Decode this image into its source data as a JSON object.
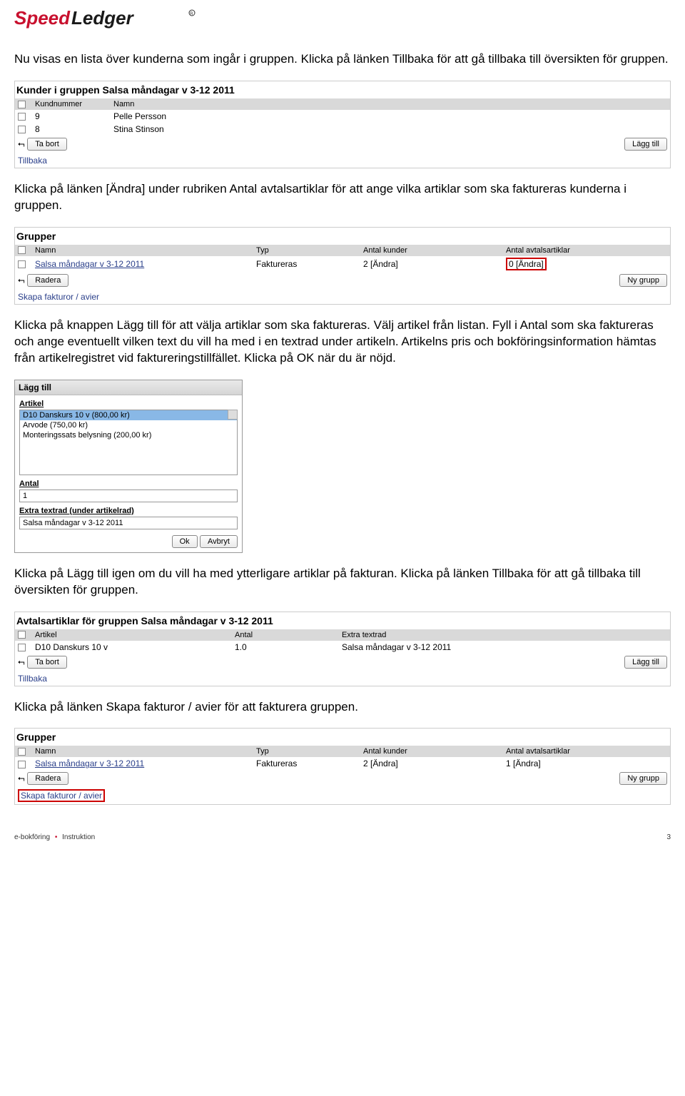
{
  "logo": {
    "brand_a": "Speed",
    "brand_b": "Ledger"
  },
  "para1": "Nu visas en lista över kunderna som ingår i gruppen. Klicka på länken Tillbaka för att gå tillbaka till översikten för gruppen.",
  "panel_kunder": {
    "title": "Kunder i gruppen Salsa måndagar v 3-12 2011",
    "col_kund": "Kundnummer",
    "col_namn": "Namn",
    "rows": [
      {
        "nr": "9",
        "namn": "Pelle Persson"
      },
      {
        "nr": "8",
        "namn": "Stina Stinson"
      }
    ],
    "ta_bort": "Ta bort",
    "lagg_till": "Lägg till",
    "tillbaka": "Tillbaka"
  },
  "para2": "Klicka på länken [Ändra] under rubriken Antal avtalsartiklar för att ange vilka artiklar som ska faktureras kunderna i gruppen.",
  "panel_grupper1": {
    "title": "Grupper",
    "col_namn": "Namn",
    "col_typ": "Typ",
    "col_antalk": "Antal kunder",
    "col_antala": "Antal avtalsartiklar",
    "row_name": "Salsa måndagar v 3-12 2011",
    "row_typ": "Faktureras",
    "row_kunder": "2 [Ändra]",
    "row_artiklar": "0 [Ändra]",
    "radera": "Radera",
    "ny_grupp": "Ny grupp",
    "skapa": "Skapa fakturor / avier"
  },
  "para3": "Klicka på knappen Lägg till för att välja artiklar som ska faktureras. Välj artikel från listan. Fyll i Antal som ska faktureras och ange eventuellt vilken text du vill ha med i en textrad under artikeln. Artikelns pris och bokföringsinformation hämtas från artikelregistret vid faktureringstillfället. Klicka på OK när du är nöjd.",
  "dialog": {
    "title": "Lägg till",
    "lbl_artikel": "Artikel",
    "options": [
      "D10 Danskurs 10 v (800,00 kr)",
      "Arvode (750,00 kr)",
      "Monteringssats belysning (200,00 kr)"
    ],
    "lbl_antal": "Antal",
    "val_antal": "1",
    "lbl_extra": "Extra textrad (under artikelrad)",
    "val_extra": "Salsa måndagar v 3-12 2011",
    "ok": "Ok",
    "avbryt": "Avbryt"
  },
  "para4": "Klicka på Lägg till igen om du vill ha med ytterligare artiklar på fakturan. Klicka på länken Tillbaka för att gå tillbaka till översikten för gruppen.",
  "panel_avtals": {
    "title": "Avtalsartiklar för gruppen Salsa måndagar v 3-12 2011",
    "col_artikel": "Artikel",
    "col_antal": "Antal",
    "col_extra": "Extra textrad",
    "row_art": "D10 Danskurs 10 v",
    "row_ant": "1.0",
    "row_extra": "Salsa måndagar v 3-12 2011",
    "ta_bort": "Ta bort",
    "lagg_till": "Lägg till",
    "tillbaka": "Tillbaka"
  },
  "para5": "Klicka på länken Skapa fakturor / avier för att fakturera gruppen.",
  "panel_grupper2": {
    "title": "Grupper",
    "col_namn": "Namn",
    "col_typ": "Typ",
    "col_antalk": "Antal kunder",
    "col_antala": "Antal avtalsartiklar",
    "row_name": "Salsa måndagar v 3-12 2011",
    "row_typ": "Faktureras",
    "row_kunder": "2 [Ändra]",
    "row_artiklar": "1 [Ändra]",
    "radera": "Radera",
    "ny_grupp": "Ny grupp",
    "skapa": "Skapa fakturor / avier"
  },
  "footer": {
    "left_a": "e-bokföring",
    "left_b": "Instruktion",
    "page": "3"
  }
}
